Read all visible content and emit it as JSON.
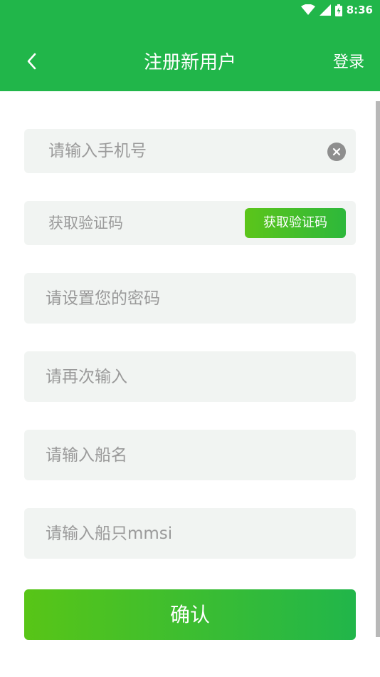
{
  "status_bar": {
    "time": "8:36",
    "icons": [
      "wifi-icon",
      "signal-icon",
      "battery-icon"
    ]
  },
  "toolbar": {
    "back_icon": "chevron-left-icon",
    "title": "注册新用户",
    "login_label": "登录"
  },
  "form": {
    "phone_placeholder": "请输入手机号",
    "code_placeholder": "获取验证码",
    "get_code_label": "获取验证码",
    "password_placeholder": "请设置您的密码",
    "password_confirm_placeholder": "请再次输入",
    "ship_name_placeholder": "请输入船名",
    "mmsi_placeholder": "请输入船只mmsi",
    "confirm_label": "确认"
  },
  "colors": {
    "brand": "#21b64a",
    "button_gradient_start": "#58c517",
    "field_bg": "#f1f4f2",
    "placeholder": "#9a9a9a"
  }
}
